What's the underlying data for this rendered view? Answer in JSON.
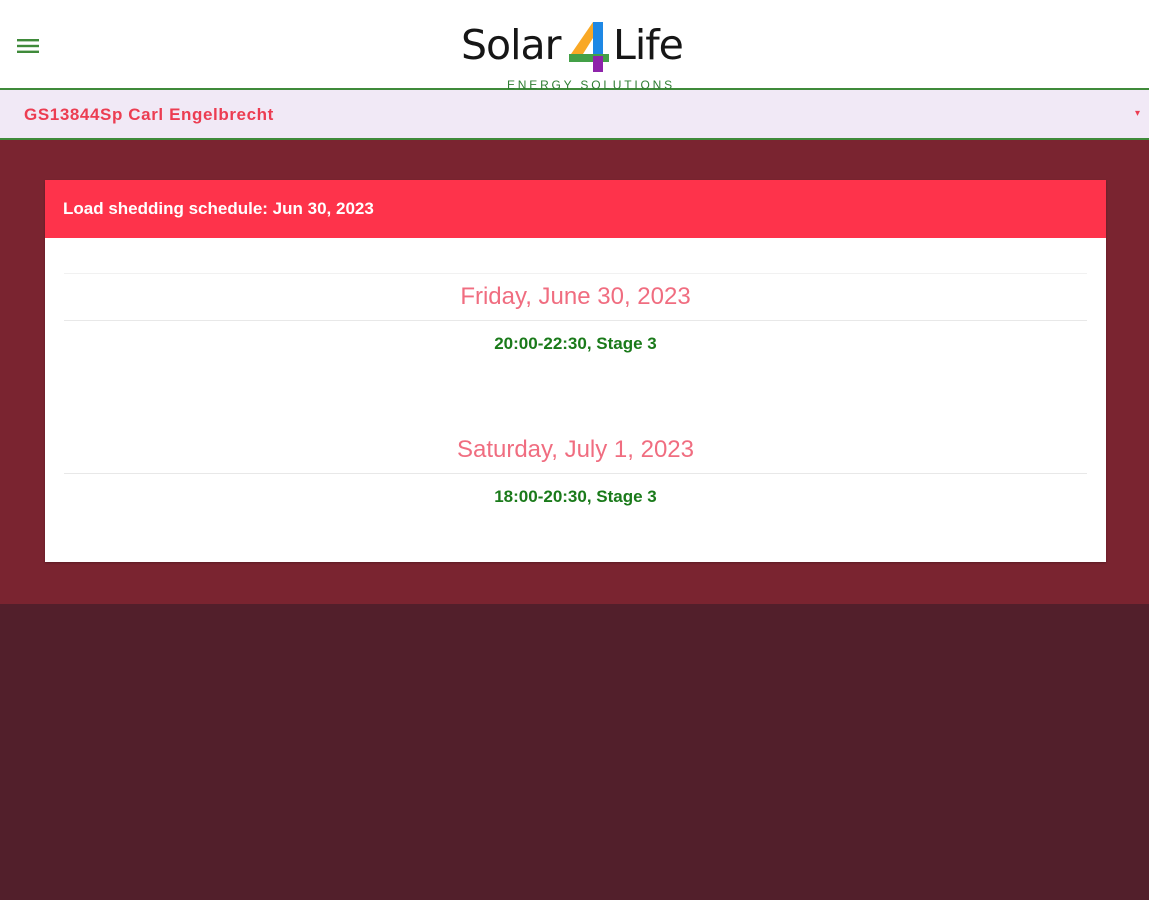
{
  "header": {
    "menu_icon": "hamburger-menu-icon",
    "logo": {
      "word_left": "Solar",
      "word_right": "Life",
      "mark": "4",
      "tagline": "ENERGY SOLUTIONS"
    }
  },
  "site_selector": {
    "label": "GS13844Sp Carl Engelbrecht",
    "caret_icon": "chevron-down-icon"
  },
  "schedule": {
    "title": "Load shedding schedule: Jun 30, 2023",
    "days": [
      {
        "date": "Friday, June 30, 2023",
        "slots": [
          "20:00-22:30, Stage 3"
        ]
      },
      {
        "date": "Saturday, July 1, 2023",
        "slots": [
          "18:00-20:30, Stage 3"
        ]
      }
    ]
  },
  "colors": {
    "header_background": "#ffffff",
    "accent_green": "#3f8a3a",
    "site_bar_background": "#f1e9f6",
    "site_label": "#ec3d52",
    "main_background": "#7a2430",
    "page_background": "#521f2b",
    "card_header": "#fe334b",
    "day_title": "#f06d80",
    "slot_text": "#1a7a1a"
  }
}
